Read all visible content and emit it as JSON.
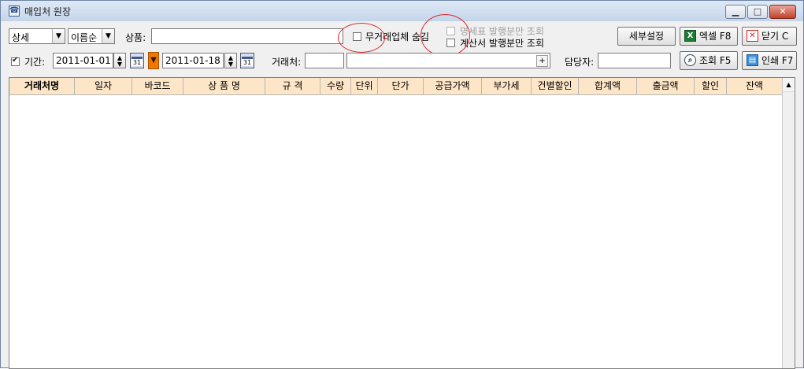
{
  "window": {
    "title": "매입처 원장",
    "minimize": "▭",
    "maximize": "□",
    "close": "✕"
  },
  "toolbar1": {
    "view_mode": "상세",
    "sort_order": "이름순",
    "product_label": "상품:",
    "product_value": "",
    "hide_inactive_vendors": {
      "label": "무거래업체 숨김",
      "checked": false
    },
    "statement_only": {
      "label": "명세표 발행분만 조회",
      "checked": false,
      "enabled": false
    },
    "invoice_only": {
      "label": "계산서 발행분만 조회",
      "checked": false
    },
    "detail_settings": "세부설정",
    "excel": "엑셀 F8",
    "close": "닫기 C"
  },
  "toolbar2": {
    "period": {
      "label": "기간:",
      "checked": true
    },
    "date_from": "2011-01-01",
    "date_to": "2011-01-18",
    "calendar_day": "31",
    "vendor_label": "거래처:",
    "vendor_code": "",
    "vendor_name": "",
    "vendor_lookup": "+",
    "manager_label": "담당자:",
    "manager_value": "",
    "search": "조회 F5",
    "print": "인쇄 F7"
  },
  "grid": {
    "columns": [
      "거래처명",
      "일자",
      "바코드",
      "상 품 명",
      "규 격",
      "수량",
      "단위",
      "단가",
      "공급가액",
      "부가세",
      "건별할인",
      "합계액",
      "출금액",
      "할인",
      "잔액"
    ],
    "rows": []
  },
  "colors": {
    "header_bg": "#fde5c7",
    "accent_orange": "#f07800",
    "annotation_red": "#e0262d"
  }
}
